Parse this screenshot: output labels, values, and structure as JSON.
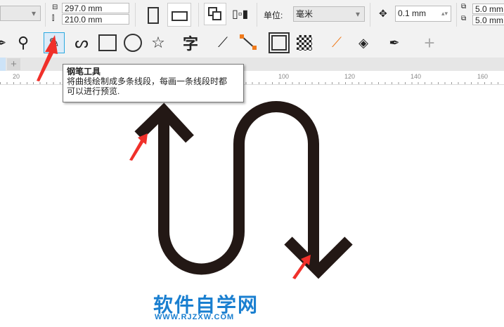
{
  "toolbar": {
    "width": "297.0 mm",
    "height": "210.0 mm",
    "unit_label": "单位:",
    "unit_value": "毫米",
    "nudge": "0.1 mm",
    "dup_x": "5.0 mm",
    "dup_y": "5.0 mm"
  },
  "tools": [
    "pick",
    "zoom",
    "pen",
    "bspline",
    "rectangle",
    "ellipse",
    "star",
    "text",
    "dimension",
    "connector",
    "contour",
    "transparency",
    "eyedropper",
    "interactive-fill",
    "outline-pen",
    "add"
  ],
  "tooltip": {
    "title": "钢笔工具",
    "line1": "将曲线绘制成多条线段，每画一条线段时都",
    "line2": "可以进行预览."
  },
  "ruler": {
    "labels": [
      "20",
      "100",
      "120",
      "140",
      "160"
    ]
  },
  "watermark": {
    "title": "软件自学网",
    "url": "WWW.RJZXW.COM"
  },
  "colors": {
    "accent": "#29a8e0",
    "stroke": "#231815",
    "arrow": "#f0302a",
    "watermark": "#1a7fd0"
  }
}
